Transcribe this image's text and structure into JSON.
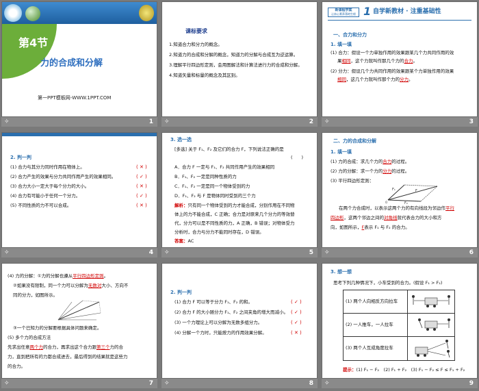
{
  "slides": [
    {
      "num": "1"
    },
    {
      "num": "2"
    },
    {
      "num": "3"
    },
    {
      "num": "4"
    },
    {
      "num": "5"
    },
    {
      "num": "6"
    },
    {
      "num": "7"
    },
    {
      "num": "8"
    },
    {
      "num": "9"
    }
  ],
  "s1": {
    "section": "第4节",
    "title": "力的合成和分解",
    "footer": "第一PPT模板网-WWW.1PPT.COM"
  },
  "s2": {
    "heading": "课标要求",
    "items": [
      "1.知道合力和分力的概念。",
      "2.知道力的合成和分解的概念，知道力的分解与合成互为逆运算。",
      "3.理解平行四边形定则，会用图解法和计算法进行力的合成和分解。",
      "4.知道矢量和标量的概念及其区别。"
    ]
  },
  "s3": {
    "logo": "新课程学案",
    "logo_sub": "让核心素养落地生根",
    "big_num": "1",
    "title": "自学新教材 · 注重基础性",
    "section": "一、合力和分力",
    "fill": "1. 填一填",
    "l1": "(1) 合力：假设一个力单独作用的效果跟某几个力共同作用的效",
    "l1b": "果",
    "a1": "相同",
    "l1c": "，这个力就叫作那几个力的",
    "a2": "合力",
    "l1d": "。",
    "l2": "(2) 分力：假设几个力共同作用的效果跟某个力单独作用的效果",
    "a3": "相同",
    "l2b": "，这几个力就叫作那个力的",
    "a4": "分力",
    "l2c": "。"
  },
  "s4": {
    "head": "2. 判一判",
    "items": [
      {
        "text": "(1) 合力与其分力同时作用在物体上。",
        "mark": "( ✕ )"
      },
      {
        "text": "(2) 合力产生的效果与分力共同作用产生的效果相同。",
        "mark": "( ✓ )"
      },
      {
        "text": "(3) 合力大小一定大于每个分力的大小。",
        "mark": "( ✕ )"
      },
      {
        "text": "(4) 合力有可能小于任何一个分力。",
        "mark": "( ✓ )"
      },
      {
        "text": "(5) 不同性质的力不可以合成。",
        "mark": "( ✕ )"
      }
    ]
  },
  "s5": {
    "head": "3. 选一选",
    "q": "[多选] 关于 F₁、F₂ 及它们的合力 F，下列说法正确的是",
    "paren": "(　　)",
    "opts": [
      "A．合力 F 一定与 F₁、F₂ 共同作用产生的效果相同",
      "B．F₁、F₂ 一定是同种性质的力",
      "C．F₁、F₂ 一定是同一个物体受到的力",
      "D．F₁、F₂ 与 F 是物体同时受到的三个力"
    ],
    "analysis_label": "解析：",
    "analysis": [
      "只有同一个物体受到的力才能合成，分别作用在不同物",
      "体上的力不能合成，C 正确；合力是对原来几个分力的等效替",
      "代，分力可以是不同性质的力，A 正确，B 错误；对物体受力",
      "分析时，合力与分力不能同时存在，D 错误。"
    ],
    "answer_label": "答案：",
    "answer": "AC"
  },
  "s6": {
    "section": "二、力的合成和分解",
    "fill": "1. 填一填",
    "l1": "(1) 力的合成：求几个力的",
    "a1": "合力",
    "l1b": "的过程。",
    "l2": "(2) 力的分解：求一个力的",
    "a2": "分力",
    "l2b": "的过程。",
    "l3": "(3) 平行四边形定则：",
    "p1": "在两个力合成时，以表示这两个力的有向线段为邻边作",
    "a3": "平行",
    "p2a": "四边形",
    "p2": "，这两个邻边之间的",
    "a4": "对角线",
    "p2b": "就代表合力的大小和方",
    "p3": "向，如图所示，",
    "a5": "F",
    "p3b": "表示 F₁ 与 F₂ 的合力。",
    "fig": {
      "F1": "F₁",
      "F2": "F₂",
      "F": "F",
      "O": "O"
    }
  },
  "s7": {
    "l1": "(4) 力的分解：①力的分解也遵从",
    "a1": "平行四边形定则",
    "l1b": "。",
    "l2": "②如果没有限制，同一个力可以分解为",
    "a2": "无数对",
    "l2b": "大小、方向不",
    "l3": "同的分力，如图所示。",
    "l4": "③一个已知力的分解要根据具体问题来确定。",
    "l5": "(5) 多个力的合成方法",
    "l6": "先求出任意",
    "a3": "两个力",
    "l6b": "的合力，再求出这个合力跟",
    "a4": "第三个",
    "l6c": "力的合",
    "l7": "力，直到把所有的力都合成进去，最后得到的结果就是这些力",
    "l8": "的合力。"
  },
  "s8": {
    "head": "2. 判一判",
    "items": [
      {
        "text": "(1) 合力 F 可以等于分力 F₁、F₂ 的和。",
        "mark": "( ✓ )"
      },
      {
        "text": "(2) 合力 F 的大小随分力 F₁、F₂ 之间夹角的增大而减小。",
        "mark": "( ✓ )"
      },
      {
        "text": "(3) 一个力理论上可以分解为无数多组分力。",
        "mark": "( ✓ )"
      },
      {
        "text": "(4) 分解一个力时，只能按力的作用效果分解。",
        "mark": "( ✕ )"
      }
    ]
  },
  "s9": {
    "head": "3. 想一想",
    "q": "思考下列几种情况下，小车受到的合力。(假设 F₁ > F₂)",
    "rows": [
      "(1) 两个人向相反方向拉车",
      "(2) 一人推车，一人拉车",
      "(3) 两个人互成角度拉车"
    ],
    "tip_label": "提示：",
    "tip": "(1) F₁ − F₂　(2) F₁ + F₂　(3) F₁ − F₂ ≤ F ≤ F₁ + F₂"
  },
  "colors": {
    "accent": "#2b6fae",
    "answer": "#d00000",
    "strip": "#8a8a8a"
  }
}
